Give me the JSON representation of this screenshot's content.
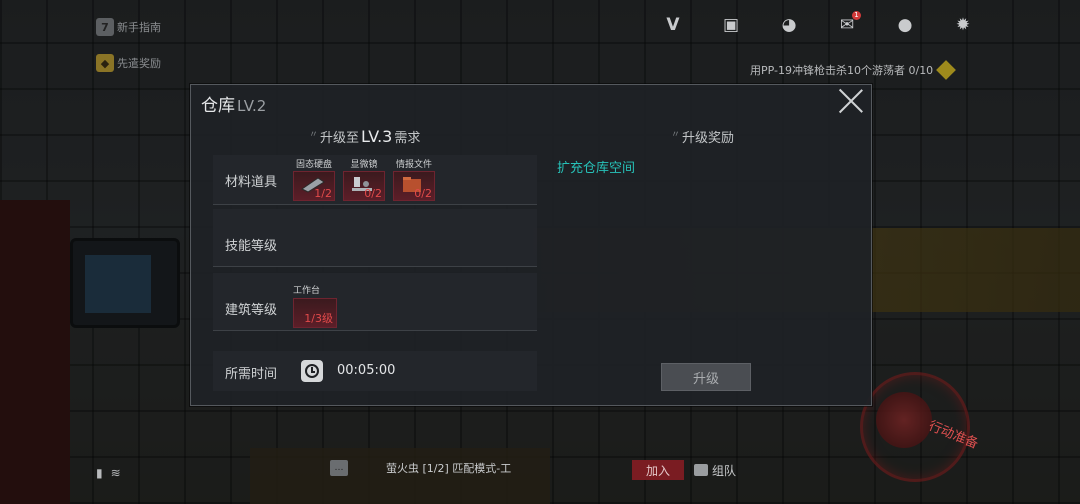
{
  "hud": {
    "guide_label": "新手指南",
    "pioneer_label": "先遣奖励",
    "mission_text": "用PP-19冲锋枪击杀10个游荡者 0/10"
  },
  "topbar": {
    "icons": [
      "v-logo-icon",
      "clipboard-icon",
      "friends-icon",
      "mail-icon",
      "profile-icon",
      "settings-icon"
    ],
    "mail_badge": "1"
  },
  "modal": {
    "title": "仓库",
    "title_level": "LV.2",
    "requirements_header_prefix": "升级至",
    "requirements_header_level": "LV.3",
    "requirements_header_suffix": "需求",
    "rewards_header": "升级奖励",
    "rows": {
      "materials_label": "材料道具",
      "skill_label": "技能等级",
      "building_label": "建筑等级",
      "time_label": "所需时间"
    },
    "materials": [
      {
        "name": "固态硬盘",
        "count": "1/2",
        "icon": "ssd-icon"
      },
      {
        "name": "显微镜",
        "count": "0/2",
        "icon": "microscope-icon"
      },
      {
        "name": "情报文件",
        "count": "0/2",
        "icon": "folder-icon"
      }
    ],
    "building": {
      "name": "工作台",
      "count": "1/3级"
    },
    "time": "00:05:00",
    "reward_text": "扩充仓库空间",
    "upgrade_button": "升级"
  },
  "bottom": {
    "chat_text": "萤火虫 [1/2] 匹配模式-工",
    "join_button": "加入",
    "team_button": "组队",
    "action_ready": "行动准备"
  },
  "colors": {
    "accent_teal": "#27c1b8",
    "warning_red": "#e24a4a",
    "item_bg": "#5c1e28"
  }
}
